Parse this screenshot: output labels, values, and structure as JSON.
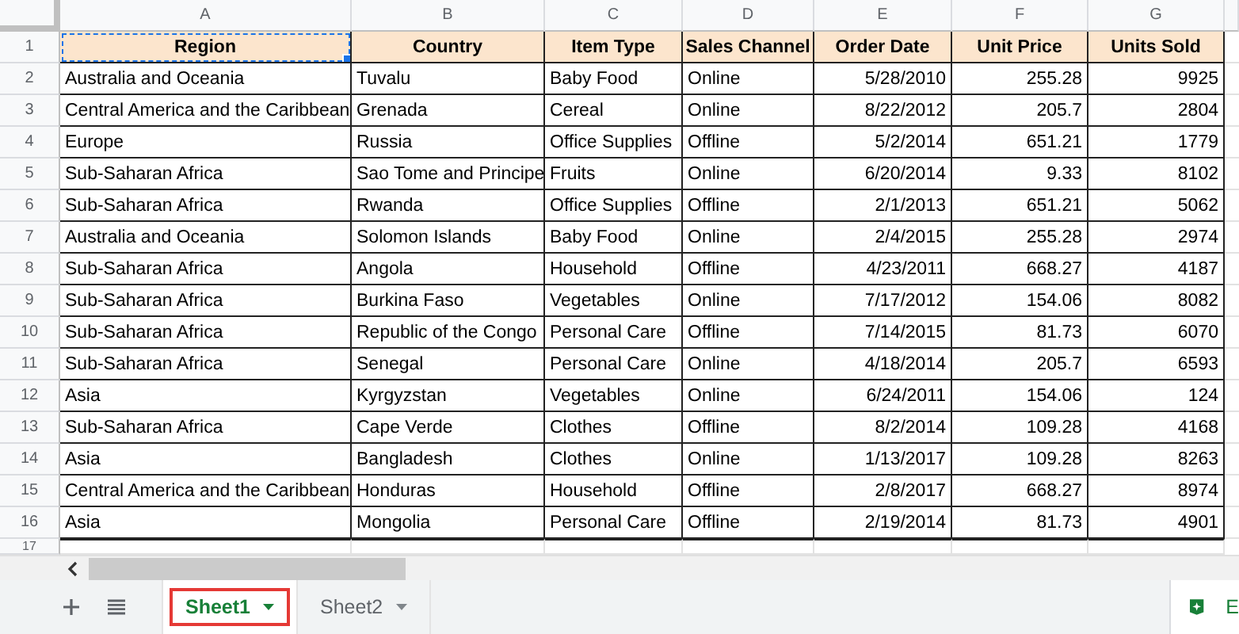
{
  "columns": [
    "A",
    "B",
    "C",
    "D",
    "E",
    "F",
    "G"
  ],
  "header_row": {
    "number": "1",
    "cells": [
      {
        "text": "Region",
        "selected": true
      },
      {
        "text": "Country",
        "selected": false
      },
      {
        "text": "Item Type",
        "selected": false
      },
      {
        "text": "Sales Channel",
        "selected": false
      },
      {
        "text": "Order Date",
        "selected": false
      },
      {
        "text": "Unit Price",
        "selected": false
      },
      {
        "text": "Units Sold",
        "selected": false
      }
    ]
  },
  "rows": [
    {
      "number": "2",
      "cells": [
        "Australia and Oceania",
        "Tuvalu",
        "Baby Food",
        "Online",
        "5/28/2010",
        "255.28",
        "9925"
      ]
    },
    {
      "number": "3",
      "cells": [
        "Central America and the Caribbean",
        "Grenada",
        "Cereal",
        "Online",
        "8/22/2012",
        "205.7",
        "2804"
      ]
    },
    {
      "number": "4",
      "cells": [
        "Europe",
        "Russia",
        "Office Supplies",
        "Offline",
        "5/2/2014",
        "651.21",
        "1779"
      ]
    },
    {
      "number": "5",
      "cells": [
        "Sub-Saharan Africa",
        "Sao Tome and Principe",
        "Fruits",
        "Online",
        "6/20/2014",
        "9.33",
        "8102"
      ]
    },
    {
      "number": "6",
      "cells": [
        "Sub-Saharan Africa",
        "Rwanda",
        "Office Supplies",
        "Offline",
        "2/1/2013",
        "651.21",
        "5062"
      ]
    },
    {
      "number": "7",
      "cells": [
        "Australia and Oceania",
        "Solomon Islands",
        "Baby Food",
        "Online",
        "2/4/2015",
        "255.28",
        "2974"
      ]
    },
    {
      "number": "8",
      "cells": [
        "Sub-Saharan Africa",
        "Angola",
        "Household",
        "Offline",
        "4/23/2011",
        "668.27",
        "4187"
      ]
    },
    {
      "number": "9",
      "cells": [
        "Sub-Saharan Africa",
        "Burkina Faso",
        "Vegetables",
        "Online",
        "7/17/2012",
        "154.06",
        "8082"
      ]
    },
    {
      "number": "10",
      "cells": [
        "Sub-Saharan Africa",
        "Republic of the Congo",
        "Personal Care",
        "Offline",
        "7/14/2015",
        "81.73",
        "6070"
      ]
    },
    {
      "number": "11",
      "cells": [
        "Sub-Saharan Africa",
        "Senegal",
        "Personal Care",
        "Online",
        "4/18/2014",
        "205.7",
        "6593"
      ]
    },
    {
      "number": "12",
      "cells": [
        "Asia",
        "Kyrgyzstan",
        "Vegetables",
        "Online",
        "6/24/2011",
        "154.06",
        "124"
      ]
    },
    {
      "number": "13",
      "cells": [
        "Sub-Saharan Africa",
        "Cape Verde",
        "Clothes",
        "Offline",
        "8/2/2014",
        "109.28",
        "4168"
      ]
    },
    {
      "number": "14",
      "cells": [
        "Asia",
        "Bangladesh",
        "Clothes",
        "Online",
        "1/13/2017",
        "109.28",
        "8263"
      ]
    },
    {
      "number": "15",
      "cells": [
        "Central America and the Caribbean",
        "Honduras",
        "Household",
        "Offline",
        "2/8/2017",
        "668.27",
        "8974"
      ]
    },
    {
      "number": "16",
      "cells": [
        "Asia",
        "Mongolia",
        "Personal Care",
        "Offline",
        "2/19/2014",
        "81.73",
        "4901"
      ]
    }
  ],
  "empty_row": {
    "number": "17"
  },
  "sheet_tabs": [
    {
      "label": "Sheet1",
      "selected": true
    },
    {
      "label": "Sheet2",
      "selected": false
    }
  ],
  "explore_button": {
    "label": "E"
  }
}
